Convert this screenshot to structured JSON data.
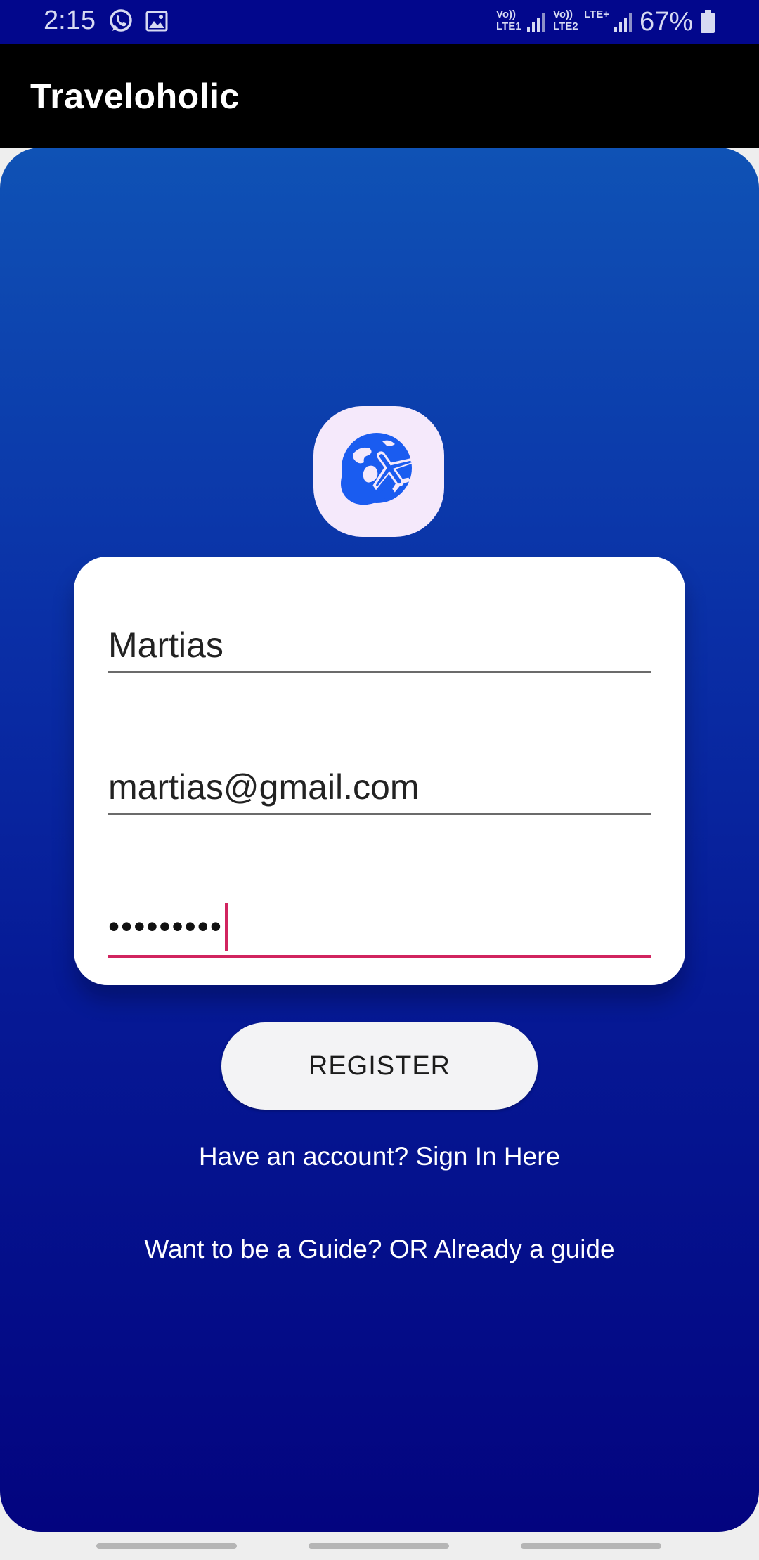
{
  "status_bar": {
    "time": "2:15",
    "sim1_volte": "Vo))",
    "sim1_lte": "LTE1",
    "sim2_volte": "Vo))",
    "sim2_lte": "LTE2",
    "sim2_network": "LTE+",
    "battery_percent": "67%",
    "icons": [
      "whatsapp-icon",
      "gallery-icon",
      "signal-icon",
      "battery-icon"
    ]
  },
  "app_bar": {
    "title": "Traveloholic"
  },
  "logo": {
    "icon": "globe-airplane-icon",
    "accent": "#1a5cf0"
  },
  "form": {
    "name_value": "Martias",
    "email_value": "martias@gmail.com",
    "password_mask": "•••••••••",
    "active_color": "#d1245f"
  },
  "actions": {
    "register_label": "REGISTER",
    "signin_link": "Have an account? Sign In Here",
    "guide_link": "Want to be a Guide? OR Already a guide"
  },
  "colors": {
    "status_bar_bg": "#02078c",
    "gradient_top": "#0f52b5",
    "gradient_bottom": "#03047f"
  }
}
